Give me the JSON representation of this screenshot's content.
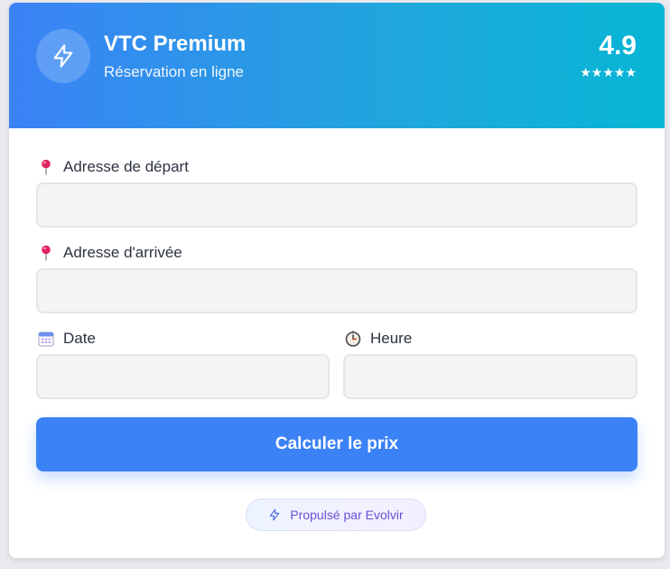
{
  "header": {
    "title": "VTC Premium",
    "subtitle": "Réservation en ligne",
    "rating": "4.9",
    "stars": "★★★★★",
    "logo_icon": "lightning-icon"
  },
  "form": {
    "departure": {
      "label": "Adresse de départ",
      "icon": "pin-icon",
      "value": ""
    },
    "arrival": {
      "label": "Adresse d'arrivée",
      "icon": "pin-icon",
      "value": ""
    },
    "date": {
      "label": "Date",
      "icon": "calendar-icon",
      "value": ""
    },
    "time": {
      "label": "Heure",
      "icon": "clock-icon",
      "value": ""
    },
    "submit_label": "Calculer le prix"
  },
  "footer": {
    "powered_label": "Propulsé par Evolvir",
    "icon": "lightning-icon"
  },
  "colors": {
    "header_gradient_start": "#3b82f6",
    "header_gradient_end": "#06b6d4",
    "button": "#3b82f6",
    "field_background": "#f3f4f6",
    "powered_text": "#6a4fd6"
  }
}
